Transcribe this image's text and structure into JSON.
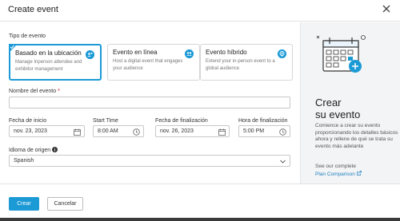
{
  "dialog": {
    "title": "Create event"
  },
  "event_type": {
    "label": "Tipo de evento",
    "options": [
      {
        "title": "Basado en la ubicación",
        "desc": "Manage Inperson attendee and exhibitor management",
        "selected": true,
        "icon": "location-person-icon"
      },
      {
        "title": "Evento en línea",
        "desc": "Host a digital event that engages your audience",
        "selected": false,
        "icon": "online-people-icon"
      },
      {
        "title": "Evento híbrido",
        "desc": "Extend your in-person event to a global audience",
        "selected": false,
        "icon": "globe-location-icon"
      }
    ]
  },
  "event_name": {
    "label": "Nombre del evento",
    "required_mark": "*",
    "value": ""
  },
  "start_date": {
    "label": "Fecha de inicio",
    "value": "nov. 23, 2023"
  },
  "start_time": {
    "label": "Start Time",
    "value": "8:00 AM"
  },
  "end_date": {
    "label": "Fecha de finalización",
    "value": "nov. 26, 2023"
  },
  "end_time": {
    "label": "Hora de finalización",
    "value": "5:00 PM"
  },
  "source_language": {
    "label": "Idioma de origen",
    "value": "Spanish"
  },
  "footer": {
    "create_label": "Crear",
    "cancel_label": "Cancelar"
  },
  "side_panel": {
    "title_line1": "Crear",
    "title_line2": "su evento",
    "description": "Comience a crear su evento proporcionando los detalles básicos ahora y rellene de qué se trata su evento más adelante",
    "see_text": "See our complete",
    "link_text": "Plan Comparison"
  },
  "colors": {
    "accent": "#1c9ad6",
    "link": "#1c7fc1",
    "required": "#d0021b"
  }
}
